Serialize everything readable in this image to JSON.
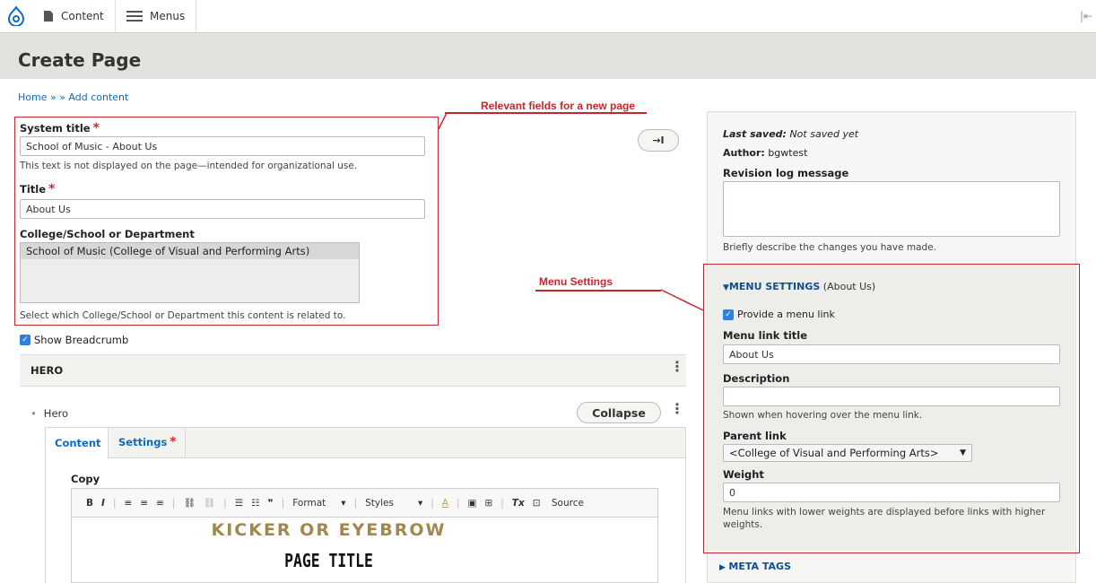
{
  "toolbar": {
    "items": [
      {
        "label": "Content",
        "icon": "content-icon"
      },
      {
        "label": "Menus",
        "icon": "menu-icon"
      }
    ],
    "collapse_glyph": "|⇤"
  },
  "page": {
    "title": "Create Page",
    "breadcrumb": "Home » » Add content"
  },
  "annotations": {
    "relevant_fields": "Relevant fields for a new page",
    "menu_settings": "Menu Settings"
  },
  "form": {
    "system_title": {
      "label": "System title",
      "required_mark": "*",
      "value": "School of Music - About Us",
      "help": "This text is not displayed on the page—intended for organizational use."
    },
    "title": {
      "label": "Title",
      "required_mark": "*",
      "value": "About Us"
    },
    "college": {
      "label": "College/School or Department",
      "selected": "School of Music (College of Visual and Performing Arts)",
      "help": "Select which College/School or Department this content is related to."
    },
    "show_breadcrumb": {
      "label": "Show Breadcrumb",
      "checked": true
    },
    "hero": {
      "section_label": "HERO",
      "item_label": "Hero",
      "collapse_label": "Collapse",
      "tabs": [
        {
          "label": "Content",
          "active": true
        },
        {
          "label": "Settings",
          "required_mark": "*"
        }
      ],
      "copy_label": "Copy",
      "editor_toolbar": {
        "format": "Format",
        "styles": "Styles",
        "source": "Source"
      },
      "preview": {
        "kicker": "KICKER OR EYEBROW",
        "page_title": "PAGE TITLE"
      }
    }
  },
  "sidebar_toggle": "→I",
  "sidebar": {
    "last_saved_label": "Last saved:",
    "last_saved_value": "Not saved yet",
    "author_label": "Author:",
    "author_value": "bgwtest",
    "revision_label": "Revision log message",
    "revision_help": "Briefly describe the changes you have made.",
    "menu": {
      "heading": "MENU SETTINGS",
      "heading_suffix": "(About Us)",
      "provide_link": "Provide a menu link",
      "provide_checked": true,
      "link_title_label": "Menu link title",
      "link_title_value": "About Us",
      "description_label": "Description",
      "description_help": "Shown when hovering over the menu link.",
      "parent_label": "Parent link",
      "parent_value": "<College of Visual and Performing Arts>",
      "weight_label": "Weight",
      "weight_value": "0",
      "weight_help": "Menu links with lower weights are displayed before links with higher weights."
    },
    "meta_tags": "META TAGS"
  },
  "colors": {
    "annotation": "#c6262e",
    "link": "#0f6bbf",
    "kicker": "#a08850"
  }
}
